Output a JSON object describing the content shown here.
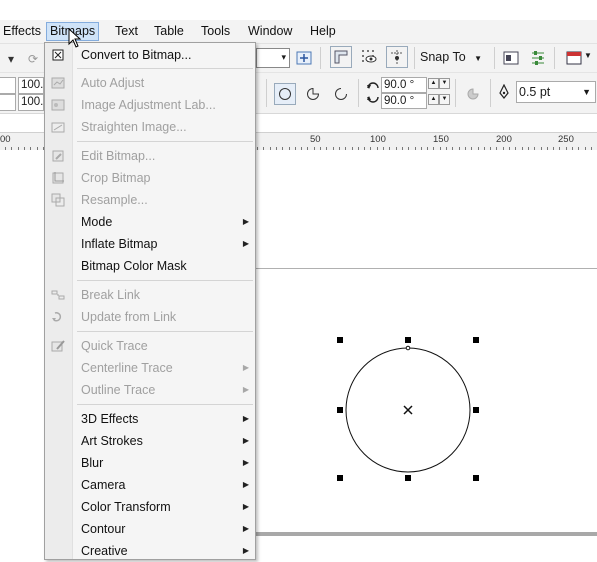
{
  "menubar": {
    "items": [
      {
        "label": "Effects"
      },
      {
        "label": "Bitmaps"
      },
      {
        "label": "Text"
      },
      {
        "label": "Table"
      },
      {
        "label": "Tools"
      },
      {
        "label": "Window"
      },
      {
        "label": "Help"
      }
    ]
  },
  "toolbar": {
    "snap_to": "Snap To",
    "zoom_w": "100.",
    "zoom_h": "100.",
    "angle1": "90.0 °",
    "angle2": "90.0 °",
    "outline_width": "0.5 pt"
  },
  "ruler": {
    "labels": [
      "00",
      "50",
      "100",
      "150",
      "200",
      "250"
    ]
  },
  "bitmaps_menu": {
    "items": [
      {
        "label": "Convert to Bitmap...",
        "enabled": true,
        "submenu": false,
        "icon": "convert-icon"
      },
      {
        "label": "Auto Adjust",
        "enabled": false,
        "submenu": false,
        "icon": "auto-adjust-icon"
      },
      {
        "label": "Image Adjustment Lab...",
        "enabled": false,
        "submenu": false,
        "icon": "adjust-lab-icon"
      },
      {
        "label": "Straighten Image...",
        "enabled": false,
        "submenu": false,
        "icon": "straighten-icon"
      },
      {
        "label": "Edit Bitmap...",
        "enabled": false,
        "submenu": false,
        "icon": "edit-bitmap-icon"
      },
      {
        "label": "Crop Bitmap",
        "enabled": false,
        "submenu": false,
        "icon": "crop-icon"
      },
      {
        "label": "Resample...",
        "enabled": false,
        "submenu": false,
        "icon": "resample-icon"
      },
      {
        "label": "Mode",
        "enabled": true,
        "submenu": true,
        "icon": ""
      },
      {
        "label": "Inflate Bitmap",
        "enabled": true,
        "submenu": true,
        "icon": ""
      },
      {
        "label": "Bitmap Color Mask",
        "enabled": true,
        "submenu": false,
        "icon": ""
      },
      {
        "label": "Break Link",
        "enabled": false,
        "submenu": false,
        "icon": "break-link-icon"
      },
      {
        "label": "Update from Link",
        "enabled": false,
        "submenu": false,
        "icon": "update-link-icon"
      },
      {
        "label": "Quick Trace",
        "enabled": false,
        "submenu": false,
        "icon": "quick-trace-icon"
      },
      {
        "label": "Centerline Trace",
        "enabled": false,
        "submenu": true,
        "icon": ""
      },
      {
        "label": "Outline Trace",
        "enabled": false,
        "submenu": true,
        "icon": ""
      },
      {
        "label": "3D Effects",
        "enabled": true,
        "submenu": true,
        "icon": ""
      },
      {
        "label": "Art Strokes",
        "enabled": true,
        "submenu": true,
        "icon": ""
      },
      {
        "label": "Blur",
        "enabled": true,
        "submenu": true,
        "icon": ""
      },
      {
        "label": "Camera",
        "enabled": true,
        "submenu": true,
        "icon": ""
      },
      {
        "label": "Color Transform",
        "enabled": true,
        "submenu": true,
        "icon": ""
      },
      {
        "label": "Contour",
        "enabled": true,
        "submenu": true,
        "icon": ""
      },
      {
        "label": "Creative",
        "enabled": true,
        "submenu": true,
        "icon": ""
      }
    ]
  },
  "colors": {
    "menu_highlight": "#cfe3f8",
    "disabled_text": "#a0a0a0"
  }
}
